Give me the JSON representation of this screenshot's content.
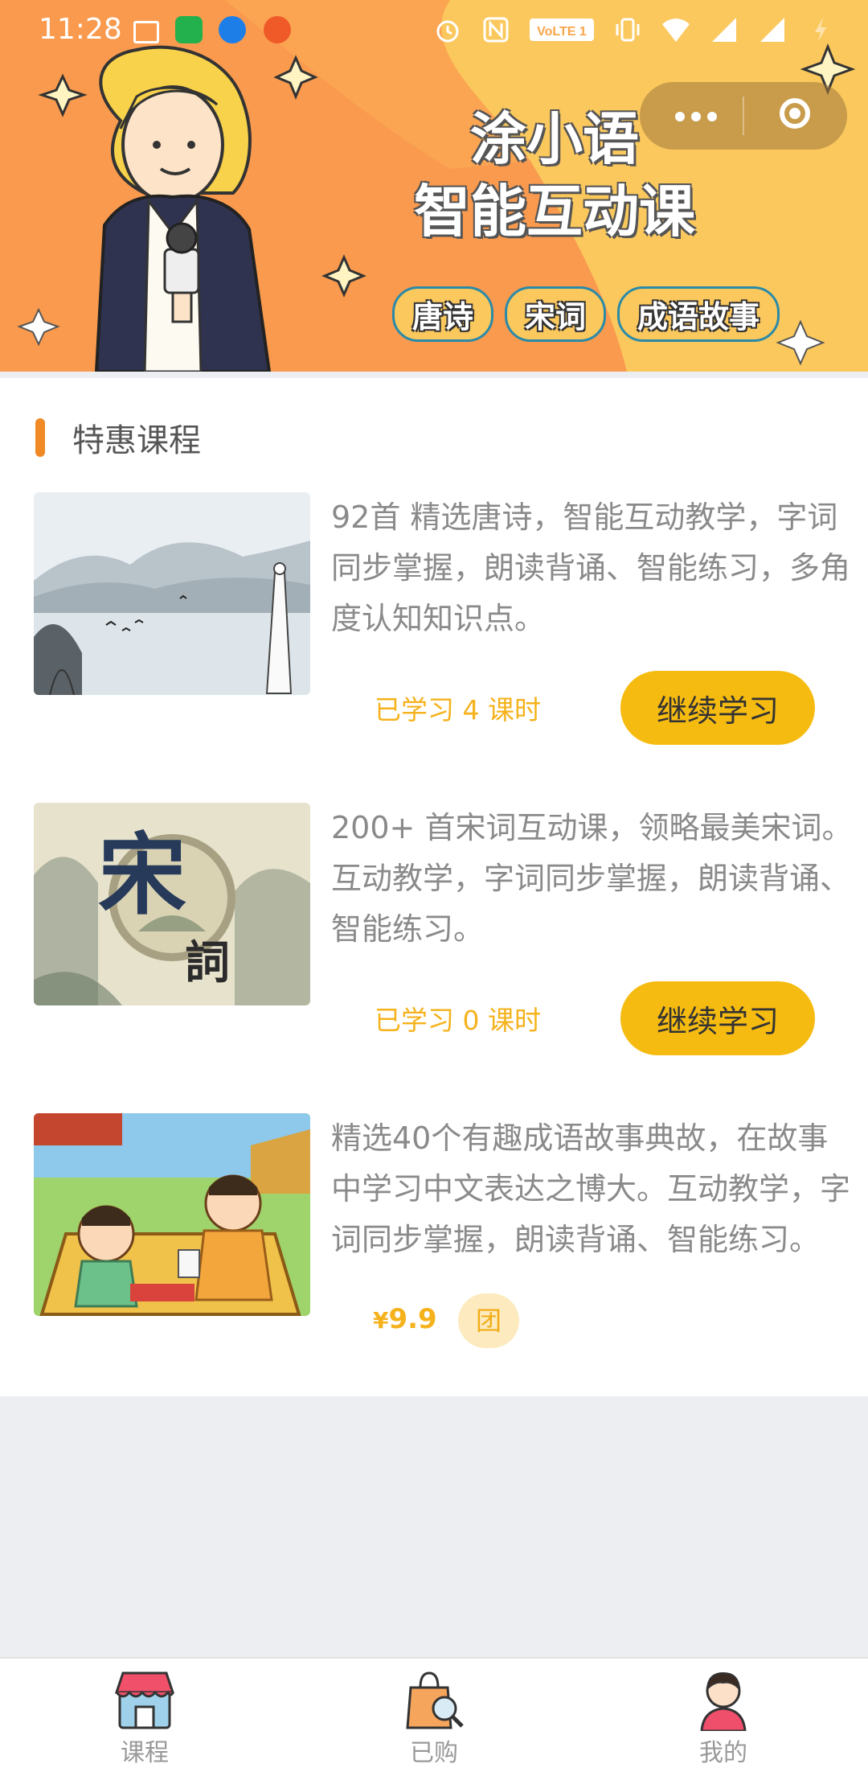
{
  "status_bar": {
    "time": "11:28",
    "notification_icons": [
      "mail-icon",
      "video-app-icon",
      "zhihu-icon",
      "red-app-icon"
    ],
    "right_icons": [
      "alarm-icon",
      "nfc-icon",
      "volte-icon",
      "vibrate-icon",
      "wifi-icon",
      "signal-icon",
      "signal-icon",
      "battery-icon"
    ],
    "volte_label": "VoLTE 1"
  },
  "capsule": {
    "more_icon": "more-dots-icon",
    "close_icon": "target-close-icon"
  },
  "banner": {
    "title_line1": "涂小语",
    "title_line2": "智能互动课",
    "tags": [
      "唐诗",
      "宋词",
      "成语故事"
    ]
  },
  "section": {
    "title": "特惠课程"
  },
  "courses": [
    {
      "desc": "92首 精选唐诗，智能互动教学，字词同步掌握，朗读背诵、智能练习，多角度认知知识点。",
      "progress_prefix": "已学习 ",
      "progress_num": "4",
      "progress_suffix": " 课时",
      "button": "继续学习"
    },
    {
      "desc": "200+ 首宋词互动课，领略最美宋词。互动教学，字词同步掌握，朗读背诵、智能练习。",
      "progress_prefix": "已学习 ",
      "progress_num": "0",
      "progress_suffix": " 课时",
      "button": "继续学习",
      "thumb_text_1": "宋",
      "thumb_text_2": "詞"
    },
    {
      "desc": "精选40个有趣成语故事典故，在故事中学习中文表达之博大。互动教学，字词同步掌握，朗读背诵、智能练习。",
      "price_symbol": "¥",
      "price": "9.9",
      "group_label": "团"
    }
  ],
  "tab_bar": {
    "tabs": [
      {
        "label": "课程",
        "icon": "shop-icon"
      },
      {
        "label": "已购",
        "icon": "shopping-bag-search-icon"
      },
      {
        "label": "我的",
        "icon": "user-avatar-icon"
      }
    ]
  },
  "colors": {
    "accent": "#f6bb10",
    "progress_text": "#f5b21c",
    "section_bar": "#f08a24",
    "banner_bg": "#fbc85d",
    "banner_orange": "#f99a4e"
  }
}
